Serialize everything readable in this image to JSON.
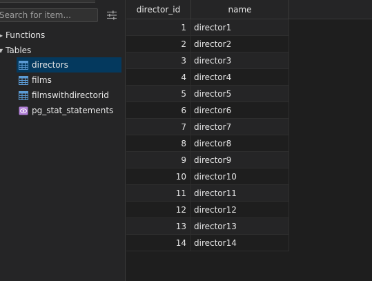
{
  "sidebar": {
    "search_placeholder": "Search for item...",
    "groups": [
      {
        "label": "Functions",
        "expanded": false
      },
      {
        "label": "Tables",
        "expanded": true
      }
    ],
    "tables": [
      {
        "label": "directors",
        "icon": "table-icon",
        "selected": true
      },
      {
        "label": "films",
        "icon": "table-icon",
        "selected": false
      },
      {
        "label": "filmswithdirectorid",
        "icon": "table-icon",
        "selected": false
      },
      {
        "label": "pg_stat_statements",
        "icon": "view-icon",
        "selected": false
      }
    ]
  },
  "grid": {
    "columns": [
      "director_id",
      "name"
    ],
    "rows": [
      [
        "1",
        "director1"
      ],
      [
        "2",
        "director2"
      ],
      [
        "3",
        "director3"
      ],
      [
        "4",
        "director4"
      ],
      [
        "5",
        "director5"
      ],
      [
        "6",
        "director6"
      ],
      [
        "7",
        "director7"
      ],
      [
        "8",
        "director8"
      ],
      [
        "9",
        "director9"
      ],
      [
        "10",
        "director10"
      ],
      [
        "11",
        "director11"
      ],
      [
        "12",
        "director12"
      ],
      [
        "13",
        "director13"
      ],
      [
        "14",
        "director14"
      ]
    ]
  },
  "colors": {
    "selected_bg": "#04395e",
    "table_icon": "#5b9bd5",
    "view_icon": "#b180d7"
  }
}
